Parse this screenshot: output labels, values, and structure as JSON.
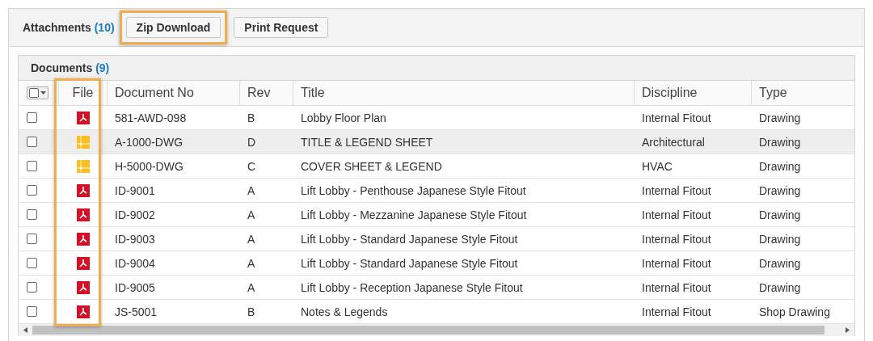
{
  "attachments": {
    "label": "Attachments",
    "count": "(10)"
  },
  "buttons": [
    {
      "label": "Zip Download",
      "highlighted": true
    },
    {
      "label": "Print Request",
      "highlighted": false
    }
  ],
  "documents": {
    "label": "Documents",
    "count": "(9)"
  },
  "table": {
    "file_column_highlighted": true,
    "columns": [
      "File",
      "Document No",
      "Rev",
      "Title",
      "Discipline",
      "Type"
    ],
    "rows": [
      {
        "checked": false,
        "kind": "pdf",
        "doc": "581-AWD-098",
        "rev": "B",
        "title": "Lobby Floor Plan",
        "discipline": "Internal Fitout",
        "type": "Drawing",
        "hovered": false
      },
      {
        "checked": false,
        "kind": "dwg",
        "doc": "A-1000-DWG",
        "rev": "D",
        "title": "TITLE & LEGEND SHEET",
        "discipline": "Architectural",
        "type": "Drawing",
        "hovered": true
      },
      {
        "checked": false,
        "kind": "dwg",
        "doc": "H-5000-DWG",
        "rev": "C",
        "title": "COVER SHEET & LEGEND",
        "discipline": "HVAC",
        "type": "Drawing",
        "hovered": false
      },
      {
        "checked": false,
        "kind": "pdf",
        "doc": "ID-9001",
        "rev": "A",
        "title": "Lift Lobby - Penthouse Japanese Style Fitout",
        "discipline": "Internal Fitout",
        "type": "Drawing",
        "hovered": false
      },
      {
        "checked": false,
        "kind": "pdf",
        "doc": "ID-9002",
        "rev": "A",
        "title": "Lift Lobby - Mezzanine Japanese Style Fitout",
        "discipline": "Internal Fitout",
        "type": "Drawing",
        "hovered": false
      },
      {
        "checked": false,
        "kind": "pdf",
        "doc": "ID-9003",
        "rev": "A",
        "title": "Lift Lobby - Standard Japanese Style Fitout",
        "discipline": "Internal Fitout",
        "type": "Drawing",
        "hovered": false
      },
      {
        "checked": false,
        "kind": "pdf",
        "doc": "ID-9004",
        "rev": "A",
        "title": "Lift Lobby - Standard Japanese Style Fitout",
        "discipline": "Internal Fitout",
        "type": "Drawing",
        "hovered": false
      },
      {
        "checked": false,
        "kind": "pdf",
        "doc": "ID-9005",
        "rev": "A",
        "title": "Lift Lobby - Reception Japanese Style Fitout",
        "discipline": "Internal Fitout",
        "type": "Drawing",
        "hovered": false
      },
      {
        "checked": false,
        "kind": "pdf",
        "doc": "JS-5001",
        "rev": "B",
        "title": "Notes & Legends",
        "discipline": "Internal Fitout",
        "type": "Shop Drawing",
        "hovered": false
      }
    ]
  }
}
